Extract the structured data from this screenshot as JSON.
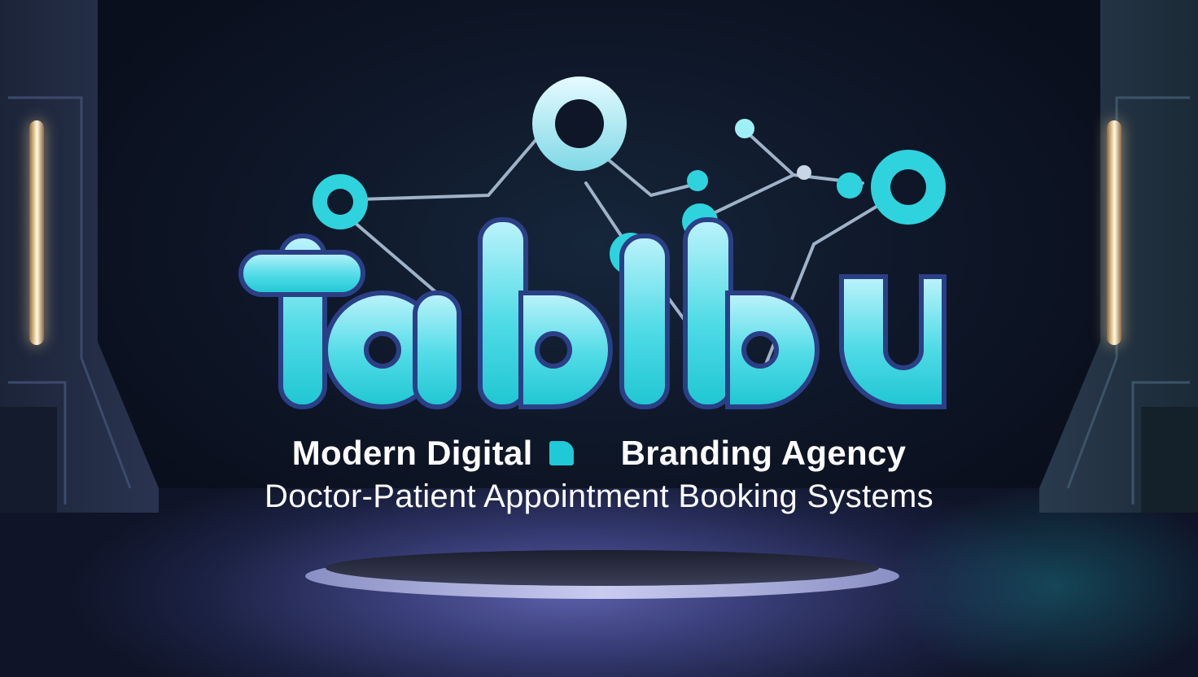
{
  "brand": {
    "wordmark": "TABIBU",
    "accent_color": "#2fd3de",
    "wire_color": "#9fb2c8"
  },
  "tagline": {
    "line1_left": "Modern Digital",
    "line1_right": "Branding Agency",
    "line2": "Doctor-Patient Appointment Booking Systems"
  },
  "scene": {
    "light_color": "#ffe7b8",
    "floor_color": "#5b5ea8",
    "background_color": "#0a0f1d"
  }
}
